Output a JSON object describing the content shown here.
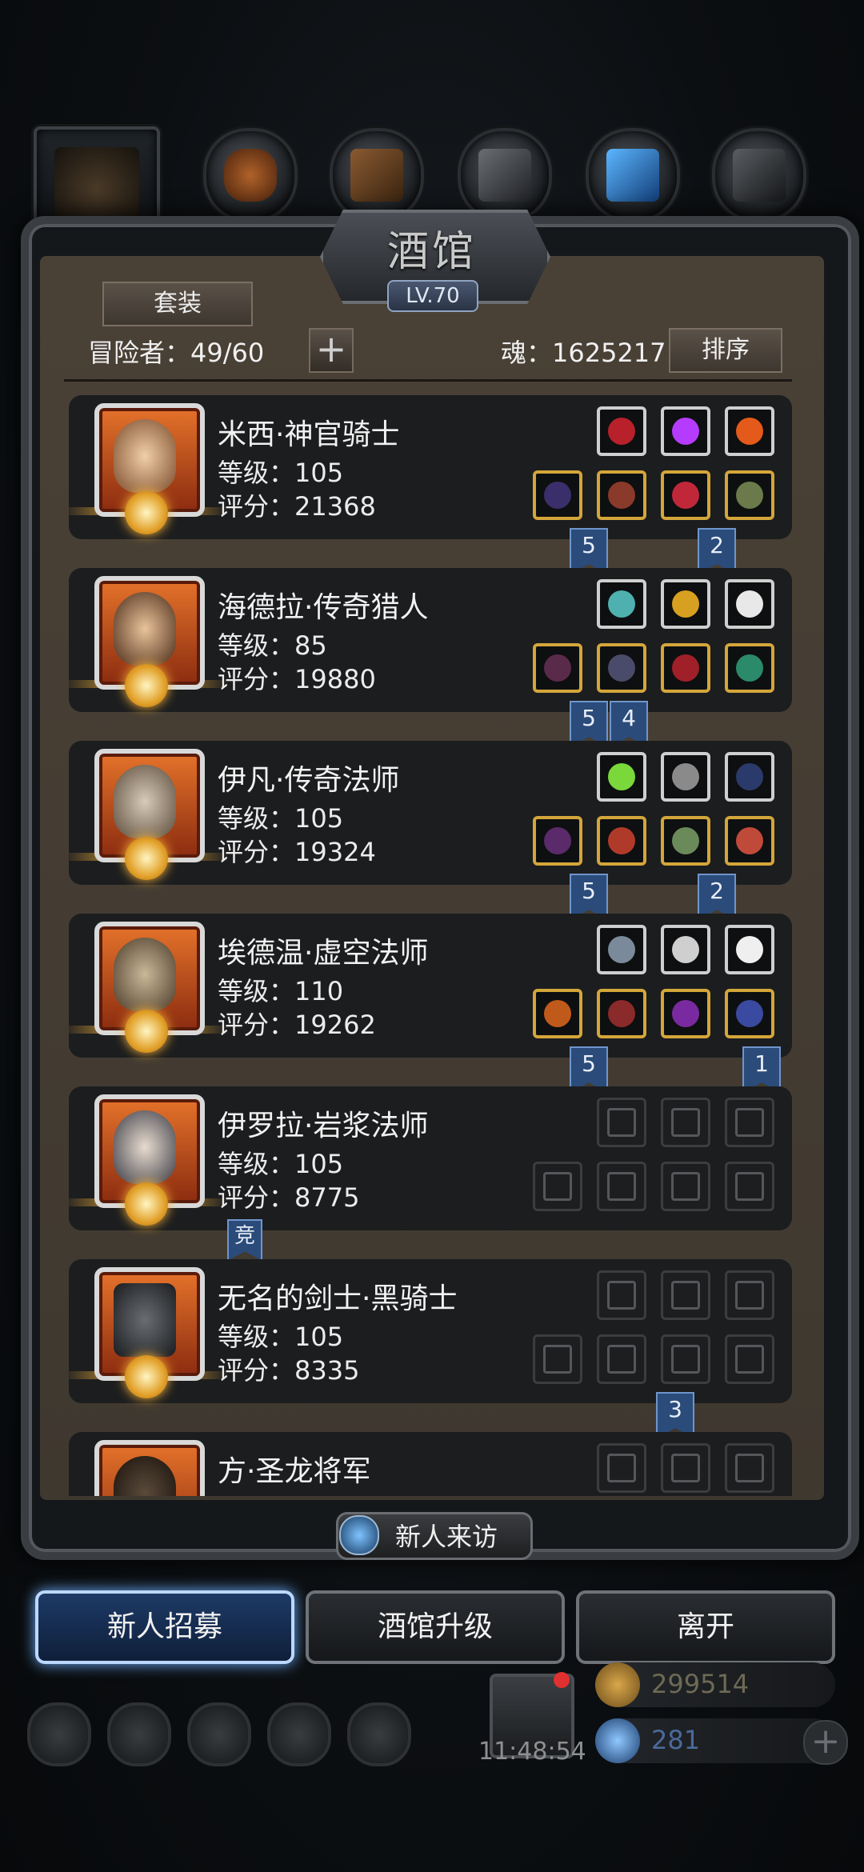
{
  "header": {
    "title": "酒馆",
    "level": "LV.70",
    "set_button": "套装",
    "adventurers_label": "冒险者：49/60",
    "add_button": "+",
    "soul_label": "魂：1625217",
    "sort_button": "排序"
  },
  "heroes": [
    {
      "name": "米西·神官骑士",
      "level": "等级：105",
      "score": "评分：21368",
      "badges": [
        "5",
        "2"
      ]
    },
    {
      "name": "海德拉·传奇猎人",
      "level": "等级：85",
      "score": "评分：19880",
      "badges": [
        "5",
        "4"
      ]
    },
    {
      "name": "伊凡·传奇法师",
      "level": "等级：105",
      "score": "评分：19324",
      "badges": [
        "5",
        "2"
      ]
    },
    {
      "name": "埃德温·虚空法师",
      "level": "等级：110",
      "score": "评分：19262",
      "badges": [
        "5",
        "1"
      ]
    },
    {
      "name": "伊罗拉·岩浆法师",
      "level": "等级：105",
      "score": "评分：8775",
      "badges": [
        "竞"
      ]
    },
    {
      "name": "无名的剑士·黑骑士",
      "level": "等级：105",
      "score": "评分：8335",
      "badges": [
        "3"
      ]
    },
    {
      "name": "方·圣龙将军",
      "level": "",
      "score": "",
      "badges": []
    }
  ],
  "footer": {
    "visitor_button": "新人来访",
    "recruit_button": "新人招募",
    "upgrade_button": "酒馆升级",
    "leave_button": "离开",
    "clock": "11:48:54",
    "gold": "299514",
    "gems": "281",
    "add_currency": "+"
  },
  "colors": {
    "panel": "#4a4136",
    "card": "#1c1d1f",
    "bookmark": "#2b4b7a",
    "active_button_glow": "#6fb0ff",
    "medal": "#e2a12a"
  }
}
